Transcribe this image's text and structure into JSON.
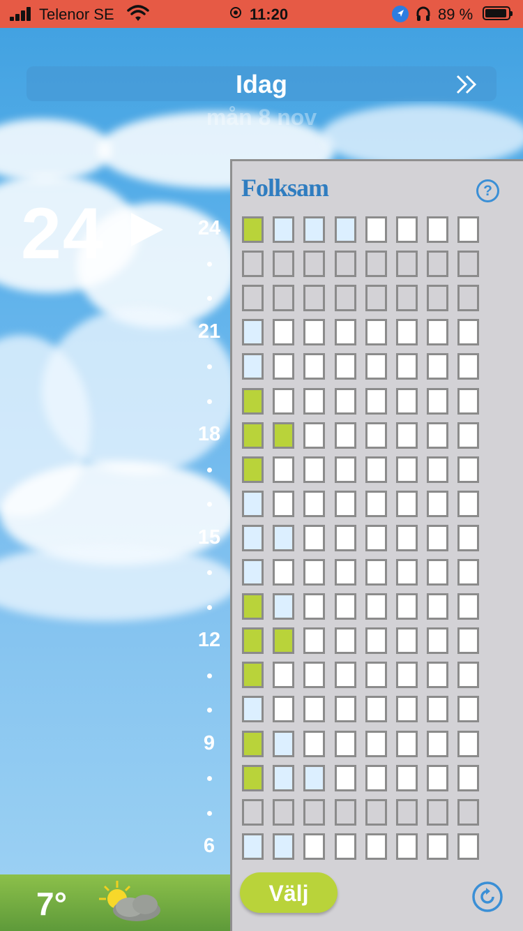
{
  "status_bar": {
    "carrier": "Telenor SE",
    "time": "11:20",
    "battery_percent": "89 %"
  },
  "header": {
    "title": "Idag",
    "date": "mån 8 nov"
  },
  "current_hour": "24",
  "hour_scale": [
    "24",
    "21",
    "18",
    "15",
    "12",
    "9",
    "6"
  ],
  "panel": {
    "brand": "Folksam",
    "help_label": "?",
    "choose_button": "Välj",
    "grid": [
      [
        "green",
        "light",
        "light",
        "light",
        "white",
        "white",
        "white",
        "white"
      ],
      [
        "grey",
        "grey",
        "grey",
        "grey",
        "grey",
        "grey",
        "grey",
        "grey"
      ],
      [
        "grey",
        "grey",
        "grey",
        "grey",
        "grey",
        "grey",
        "grey",
        "grey"
      ],
      [
        "light",
        "white",
        "white",
        "white",
        "white",
        "white",
        "white",
        "white"
      ],
      [
        "light",
        "white",
        "white",
        "white",
        "white",
        "white",
        "white",
        "white"
      ],
      [
        "green",
        "white",
        "white",
        "white",
        "white",
        "white",
        "white",
        "white"
      ],
      [
        "green",
        "green",
        "white",
        "white",
        "white",
        "white",
        "white",
        "white"
      ],
      [
        "green",
        "white",
        "white",
        "white",
        "white",
        "white",
        "white",
        "white"
      ],
      [
        "light",
        "white",
        "white",
        "white",
        "white",
        "white",
        "white",
        "white"
      ],
      [
        "light",
        "light",
        "white",
        "white",
        "white",
        "white",
        "white",
        "white"
      ],
      [
        "light",
        "white",
        "white",
        "white",
        "white",
        "white",
        "white",
        "white"
      ],
      [
        "green",
        "light",
        "white",
        "white",
        "white",
        "white",
        "white",
        "white"
      ],
      [
        "green",
        "green",
        "white",
        "white",
        "white",
        "white",
        "white",
        "white"
      ],
      [
        "green",
        "white",
        "white",
        "white",
        "white",
        "white",
        "white",
        "white"
      ],
      [
        "light",
        "white",
        "white",
        "white",
        "white",
        "white",
        "white",
        "white"
      ],
      [
        "green",
        "light",
        "white",
        "white",
        "white",
        "white",
        "white",
        "white"
      ],
      [
        "green",
        "light",
        "light",
        "white",
        "white",
        "white",
        "white",
        "white"
      ],
      [
        "grey",
        "grey",
        "grey",
        "grey",
        "grey",
        "grey",
        "grey",
        "grey"
      ],
      [
        "light",
        "light",
        "white",
        "white",
        "white",
        "white",
        "white",
        "white"
      ]
    ]
  },
  "bottom": {
    "temperature": "7°",
    "weather_icon": "partly-cloudy-icon"
  },
  "colors": {
    "status_bar": "#e65a45",
    "accent_green": "#b9d33a",
    "brand_blue": "#2f7dc0",
    "cell_light": "#dcefff",
    "panel_bg": "#d3d2d6"
  }
}
